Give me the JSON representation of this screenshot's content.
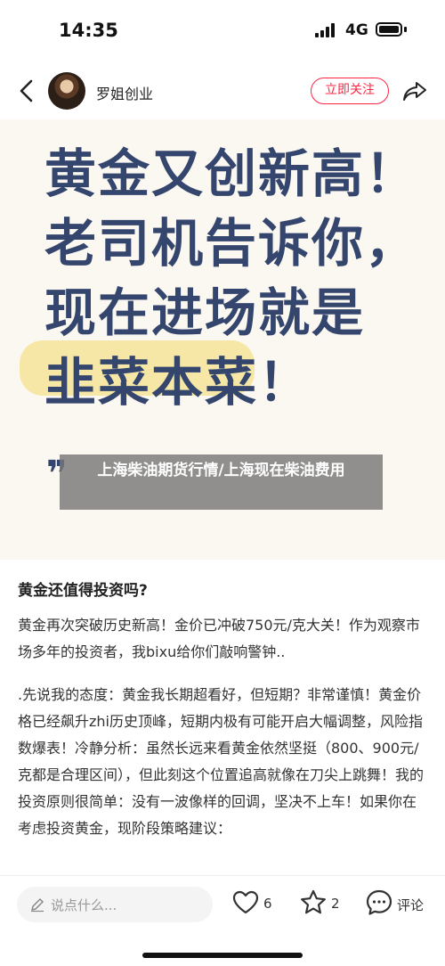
{
  "status_bar": {
    "time": "14:35",
    "network": "4G"
  },
  "nav": {
    "author_name": "罗姐创业",
    "follow_label": "立即关注"
  },
  "hero": {
    "lines": [
      "黄金又创新高！",
      "老司机告诉你，",
      "现在进场就是",
      "韭菜本菜！"
    ],
    "overlay_title": "上海柴油期货行情/上海现在柴油费用"
  },
  "article": {
    "heading": "黄金还值得投资吗?",
    "paragraphs": [
      "黄金再次突破历史新高！金价已冲破750元/克大关！作为观察市场多年的投资者，我bixu给你们敲响警钟..",
      ".先说我的态度：黄金我长期超看好，但短期？非常谨慎！黄金价格已经飙升zhi历史顶峰，短期内极有可能开启大幅调整，风险指数爆表！冷静分析：虽然长远来看黄金依然坚挺（800、900元/克都是合理区间），但此刻这个位置追高就像在刀尖上跳舞！我的投资原则很简单：没有一波像样的回调，坚决不上车！如果你在考虑投资黄金，现阶段策略建议："
    ]
  },
  "bottom_bar": {
    "comment_placeholder": "说点什么...",
    "likes": "6",
    "favorites": "2",
    "comment_label": "评论"
  },
  "colors": {
    "accent": "#ff2442",
    "hero_text": "#35466e",
    "hero_bg": "#fbf7f1",
    "highlight": "#f6e7a6"
  },
  "icons": [
    "back-icon",
    "share-icon",
    "pencil-icon",
    "heart-icon",
    "star-icon",
    "comment-icon"
  ]
}
